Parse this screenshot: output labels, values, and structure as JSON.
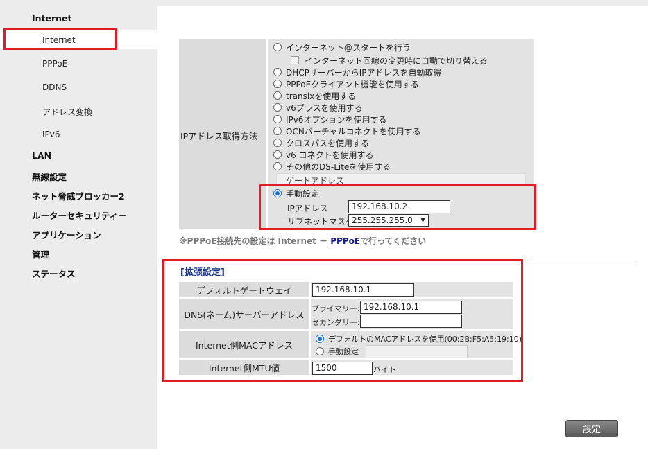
{
  "sidebar": {
    "section_internet": "Internet",
    "internet_items": [
      "Internet",
      "PPPoE",
      "DDNS",
      "アドレス変換",
      "IPv6"
    ],
    "sections": [
      "LAN",
      "無線設定",
      "ネット脅威ブロッカー2",
      "ルーターセキュリティー",
      "アプリケーション",
      "管理",
      "ステータス"
    ]
  },
  "ip_method": {
    "label": "IPアドレス取得方法",
    "options": [
      "インターネット@スタートを行う",
      "インターネット回線の変更時に自動で切り替える",
      "DHCPサーバーからIPアドレスを自動取得",
      "PPPoEクライアント機能を使用する",
      "transixを使用する",
      "v6プラスを使用する",
      "IPv6オプションを使用する",
      "OCNバーチャルコネクトを使用する",
      "クロスパスを使用する",
      "v6 コネクトを使用する",
      "その他のDS-Liteを使用する"
    ],
    "gateway_label": "ゲートアドレス",
    "manual_label": "手動設定",
    "ip_label": "IPアドレス",
    "ip_value": "192.168.10.2",
    "subnet_label": "サブネットマスク",
    "subnet_value": "255.255.255.0",
    "selected": "手動設定"
  },
  "note": {
    "prefix": "※PPPoE接続先の設定は Internet － ",
    "link": "PPPoE",
    "suffix": "で行ってください"
  },
  "extended": {
    "title": "[拡張設定]",
    "default_gw_label": "デフォルトゲートウェイ",
    "default_gw_value": "192.168.10.1",
    "dns_label": "DNS(ネーム)サーバーアドレス",
    "dns_primary_label": "プライマリー:",
    "dns_primary_value": "192.168.10.1",
    "dns_secondary_label": "セカンダリー:",
    "dns_secondary_value": "",
    "mac_label": "Internet側MACアドレス",
    "mac_default_option": "デフォルトのMACアドレスを使用(00:2B:F5:A5:19:10)",
    "mac_manual_option": "手動設定",
    "mtu_label": "Internet側MTU値",
    "mtu_value": "1500",
    "mtu_unit": "バイト"
  },
  "buttons": {
    "set": "設定"
  },
  "colors": {
    "highlight_border": "#e01c24",
    "link": "#1a1a8c",
    "title": "#1e3a8a"
  }
}
